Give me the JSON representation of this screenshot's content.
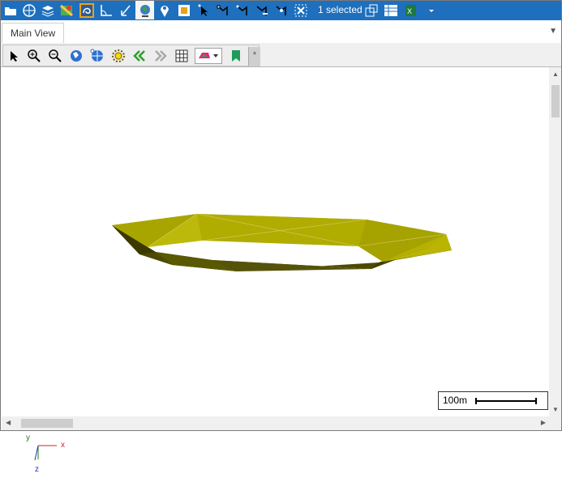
{
  "ribbon": {
    "selection_label": "1 selected",
    "buttons": [
      "open-folder-icon",
      "globe-settings-icon",
      "layers-icon",
      "map-icon",
      "feature-icon",
      "angle-icon",
      "transform-icon",
      "globe-icon",
      "pin-icon",
      "select-box-icon",
      "select-pointer-icon",
      "edit-vertices-icon",
      "add-vertex-icon",
      "delete-vertex-icon",
      "move-vertex-icon",
      "clear-selection-icon",
      "copy-to-layer-icon",
      "attribute-table-icon",
      "excel-export-icon",
      "more-dropdown-icon"
    ],
    "accent": "#1e6fbd"
  },
  "tabs": [
    {
      "label": "Main View",
      "active": true
    }
  ],
  "toolbar": {
    "buttons": [
      "pointer-icon",
      "zoom-in-icon",
      "zoom-out-icon",
      "globe-view-icon",
      "globe-network-icon",
      "sun-icon",
      "rewind-icon",
      "forward-icon",
      "grid-icon",
      "color-style-dropdown",
      "bookmark-icon"
    ],
    "extra_label": "*"
  },
  "viewport": {
    "scale_label": "100m",
    "axes": {
      "x": "x",
      "y": "y",
      "z": "z"
    },
    "surface_color": "#b5b100"
  }
}
